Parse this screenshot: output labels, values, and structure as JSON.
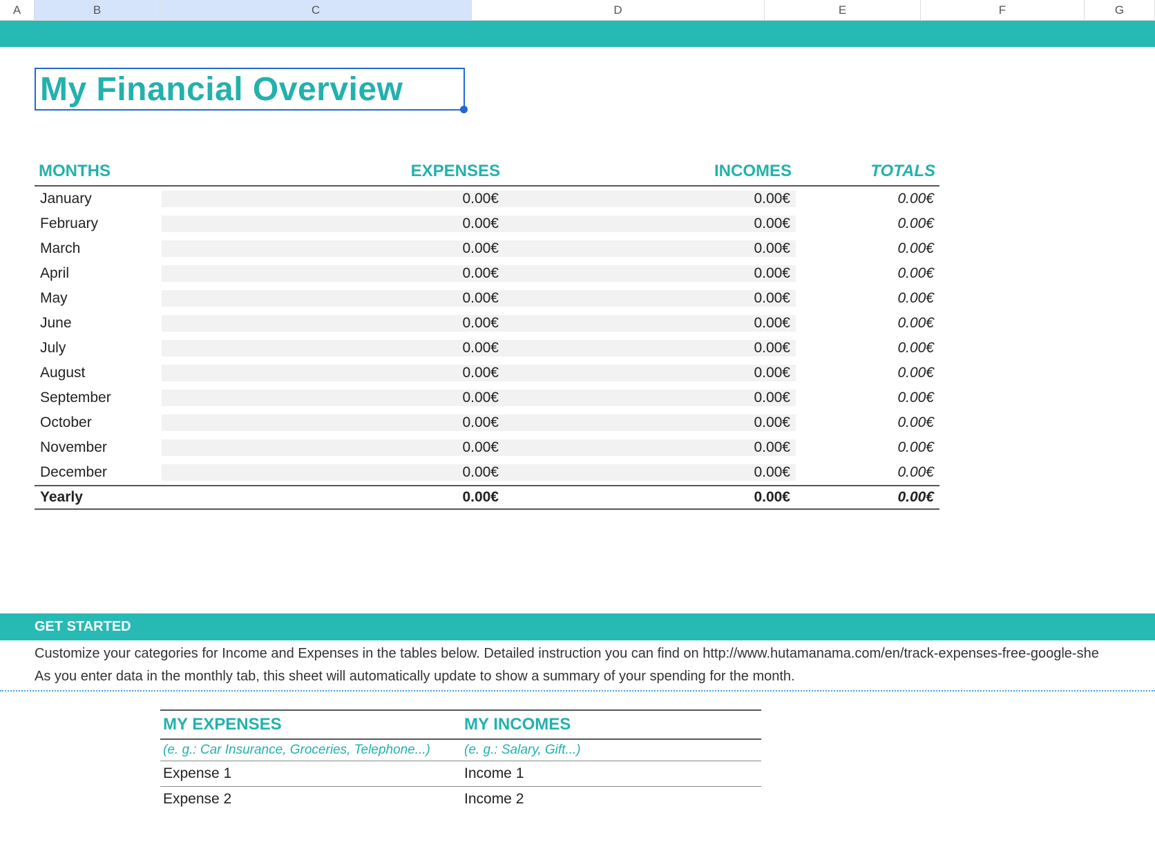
{
  "columns": {
    "A": "A",
    "B": "B",
    "C": "C",
    "D": "D",
    "E": "E",
    "F": "F",
    "G": "G"
  },
  "title": "My Financial Overview",
  "headers": {
    "months": "MONTHS",
    "expenses": "EXPENSES",
    "incomes": "INCOMES",
    "totals": "TOTALS"
  },
  "rows": [
    {
      "month": "January",
      "exp": "0.00€",
      "inc": "0.00€",
      "tot": "0.00€"
    },
    {
      "month": "February",
      "exp": "0.00€",
      "inc": "0.00€",
      "tot": "0.00€"
    },
    {
      "month": "March",
      "exp": "0.00€",
      "inc": "0.00€",
      "tot": "0.00€"
    },
    {
      "month": "April",
      "exp": "0.00€",
      "inc": "0.00€",
      "tot": "0.00€"
    },
    {
      "month": "May",
      "exp": "0.00€",
      "inc": "0.00€",
      "tot": "0.00€"
    },
    {
      "month": "June",
      "exp": "0.00€",
      "inc": "0.00€",
      "tot": "0.00€"
    },
    {
      "month": "July",
      "exp": "0.00€",
      "inc": "0.00€",
      "tot": "0.00€"
    },
    {
      "month": "August",
      "exp": "0.00€",
      "inc": "0.00€",
      "tot": "0.00€"
    },
    {
      "month": "September",
      "exp": "0.00€",
      "inc": "0.00€",
      "tot": "0.00€"
    },
    {
      "month": "October",
      "exp": "0.00€",
      "inc": "0.00€",
      "tot": "0.00€"
    },
    {
      "month": "November",
      "exp": "0.00€",
      "inc": "0.00€",
      "tot": "0.00€"
    },
    {
      "month": "December",
      "exp": "0.00€",
      "inc": "0.00€",
      "tot": "0.00€"
    }
  ],
  "yearly": {
    "label": "Yearly",
    "exp": "0.00€",
    "inc": "0.00€",
    "tot": "0.00€"
  },
  "get_started": {
    "heading": "GET STARTED",
    "line1": "Customize your categories for Income and Expenses in the tables below. Detailed instruction you can find on http://www.hutamanama.com/en/track-expenses-free-google-she",
    "line2": "As you enter data in the monthly tab, this sheet will automatically update to show a summary of your spending for the month."
  },
  "categories": {
    "exp_header": "MY EXPENSES",
    "inc_header": "MY INCOMES",
    "exp_hint": "(e. g.: Car Insurance, Groceries, Telephone...)",
    "inc_hint": "(e. g.: Salary, Gift...)",
    "rows": [
      {
        "exp": "Expense 1",
        "inc": "Income 1"
      },
      {
        "exp": "Expense 2",
        "inc": "Income 2"
      }
    ]
  }
}
